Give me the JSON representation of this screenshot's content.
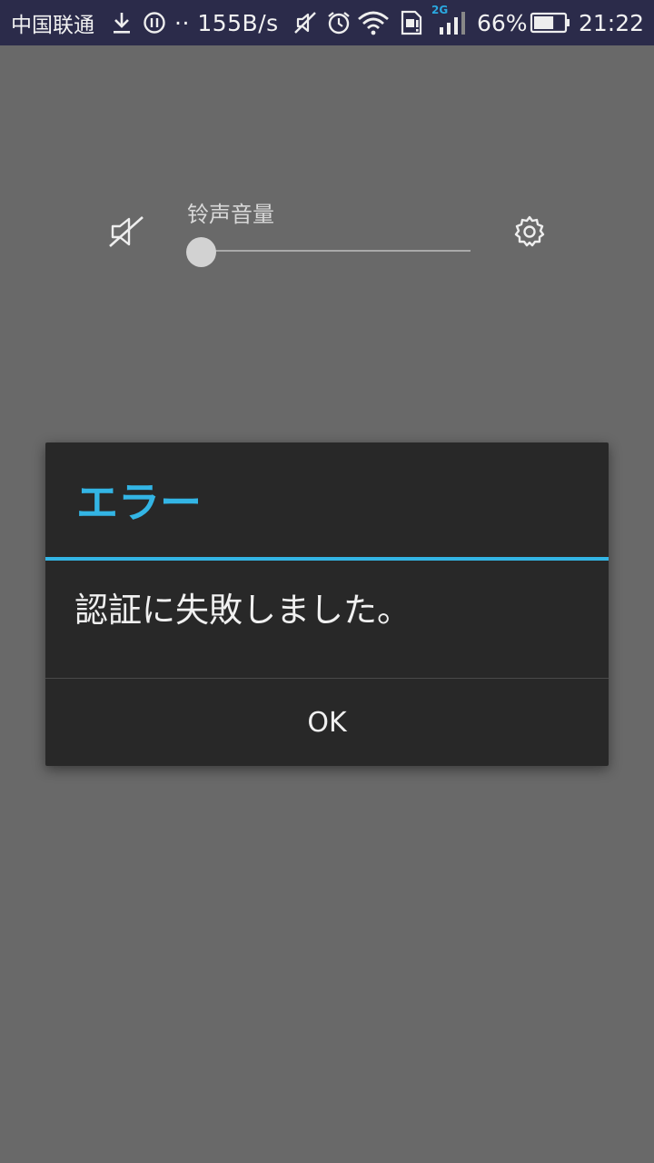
{
  "status_bar": {
    "carrier": "中国联通",
    "net_speed": "·· 155B/s",
    "network_type": "2G",
    "battery_percent": "66%",
    "time": "21:22",
    "battery_level": 0.66,
    "icons": [
      "download-icon",
      "usb-debug-icon",
      "mute-icon",
      "alarm-icon",
      "wifi-icon",
      "sim-alert-icon",
      "signal-icon",
      "battery-icon"
    ]
  },
  "volume_panel": {
    "title": "铃声音量",
    "level": 0,
    "icons": [
      "speaker-mute-icon",
      "settings-gear-icon"
    ]
  },
  "dialog": {
    "title": "エラー",
    "message": "認証に失敗しました。",
    "button_label": "OK",
    "accent_color": "#33b5e5"
  }
}
